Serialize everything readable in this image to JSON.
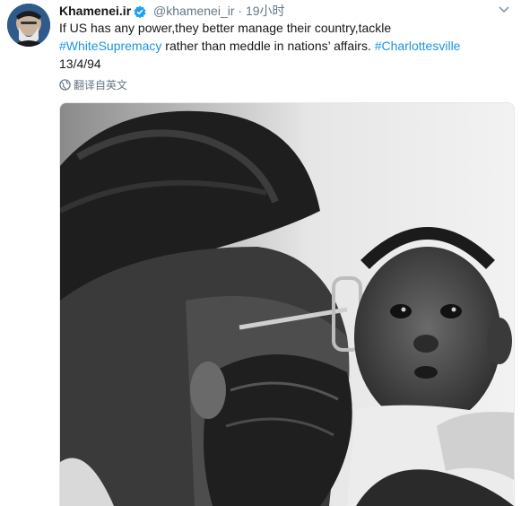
{
  "tweet": {
    "display_name": "Khamenei.ir",
    "handle": "@khamenei_ir",
    "separator": "·",
    "time": "19小时",
    "text_part1": "If US has any power,they better manage their country,tackle",
    "hashtag1": "#WhiteSupremacy",
    "text_part2": " rather than meddle in nations’ affairs. ",
    "hashtag2": "#Charlottesville",
    "date_line": "13/4/94",
    "translate_label": "翻译自英文"
  },
  "icons": {
    "verified": "verified-badge-icon",
    "caret": "chevron-down-icon",
    "translate": "globe-icon"
  },
  "colors": {
    "link": "#1b95e0",
    "secondary_text": "#657786",
    "primary_text": "#14171a"
  }
}
